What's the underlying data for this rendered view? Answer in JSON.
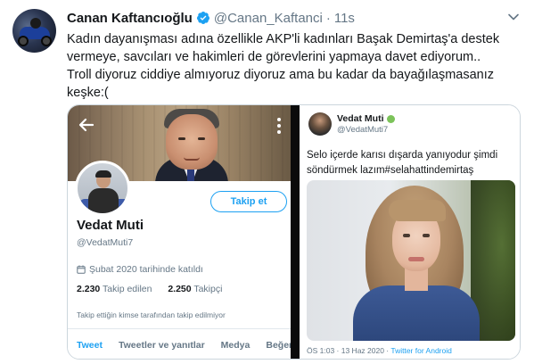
{
  "tweet": {
    "author_name": "Canan Kaftancıoğlu",
    "handle": "@Canan_Kaftanci",
    "separator": "·",
    "time": "11s",
    "text_lines": [
      "Kadın dayanışması adına özellikle AKP'li kadınları Başak Demirtaş'a  destek",
      "vermeye, savcıları ve hakimleri de görevlerini yapmaya davet ediyorum..",
      " Troll diyoruz ciddiye almıyoruz diyoruz ama bu kadar da bayağılaşmasanız",
      "keşke:("
    ]
  },
  "screenshot_left": {
    "profile_name": "Vedat Muti",
    "profile_handle": "@VedatMuti7",
    "follow_label": "Takip et",
    "joined": "Şubat 2020 tarihinde katıldı",
    "following_count": "2.230",
    "following_label": "Takip edilen",
    "followers_count": "2.250",
    "followers_label": "Takipçi",
    "note": "Takip ettiğin kimse tarafından takip edilmiyor",
    "tabs": [
      {
        "label": "Tweet"
      },
      {
        "label": "Tweetler ve yanıtlar"
      },
      {
        "label": "Medya"
      },
      {
        "label": "Beğen"
      }
    ]
  },
  "screenshot_right": {
    "author_name": "Vedat Muti",
    "handle": "@VedatMuti7",
    "text_lines": [
      "Selo içerde karısı dışarda yanıyodur şimdi",
      "söndürmek lazım#selahattindemirtaş"
    ],
    "footer_time": "ÖS 1:03 · 13 Haz 2020 · ",
    "footer_source": "Twitter for Android"
  },
  "colors": {
    "accent": "#1da1f2",
    "text": "#14171a",
    "muted": "#657786"
  }
}
